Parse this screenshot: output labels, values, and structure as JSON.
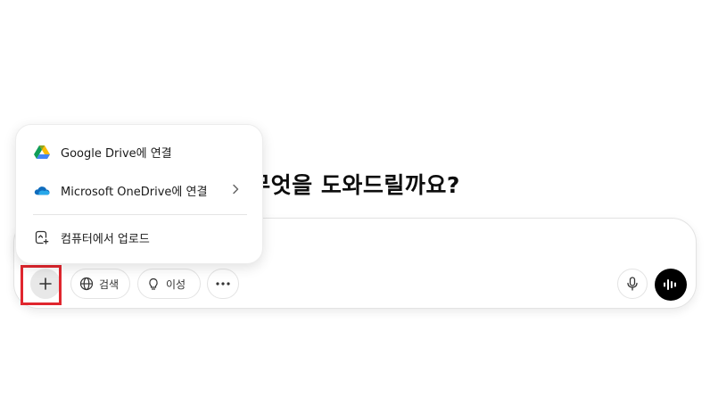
{
  "main": {
    "heading": "무엇을 도와드릴까요?"
  },
  "composer": {
    "placeholder": "",
    "search_label": "검색",
    "reason_label": "이성",
    "icons": {
      "add": "plus-icon",
      "search": "globe-icon",
      "reason": "lightbulb-icon",
      "more": "more-dots-icon",
      "mic": "microphone-icon",
      "voice": "voice-waveform-icon"
    }
  },
  "attach_menu": {
    "items": [
      {
        "label": "Google Drive에 연결",
        "icon": "google-drive-icon",
        "has_submenu": false
      },
      {
        "label": "Microsoft OneDrive에 연결",
        "icon": "onedrive-icon",
        "has_submenu": true
      },
      {
        "label": "컴퓨터에서 업로드",
        "icon": "upload-file-icon",
        "has_submenu": false
      }
    ]
  },
  "annotation": {
    "highlight_color": "#e0262e"
  }
}
